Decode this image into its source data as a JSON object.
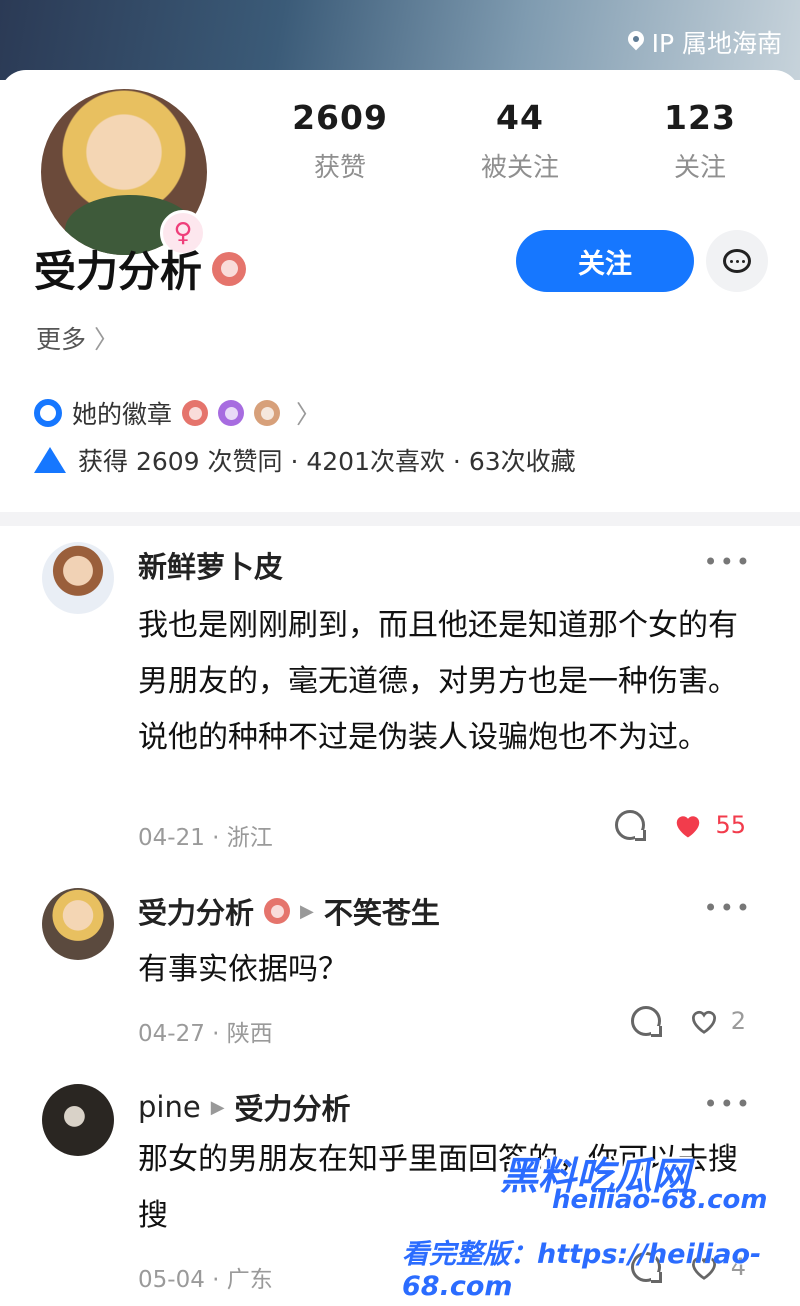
{
  "header": {
    "ip_location": "IP 属地海南",
    "gender_symbol": "♀"
  },
  "profile": {
    "stats": [
      {
        "value": "2609",
        "label": "获赞"
      },
      {
        "value": "44",
        "label": "被关注"
      },
      {
        "value": "123",
        "label": "关注"
      }
    ],
    "name": "受力分析",
    "follow_label": "关注",
    "more_label": "更多",
    "badges_label": "她的徽章",
    "summary": "获得 2609 次赞同 · 4201次喜欢 · 63次收藏"
  },
  "comments": [
    {
      "user": "新鲜萝卜皮",
      "reply_to": "",
      "text": "我也是刚刚刷到，而且他还是知道那个女的有男朋友的，毫无道德，对男方也是一种伤害。说他的种种不过是伪装人设骗炮也不为过。",
      "meta": "04-21 · 浙江",
      "likes": "55",
      "liked": true
    },
    {
      "user": "受力分析",
      "reply_to": "不笑苍生",
      "text": "有事实依据吗？",
      "meta": "04-27 · 陕西",
      "likes": "2",
      "liked": false
    },
    {
      "user": "pine",
      "reply_to": "受力分析",
      "text": "那女的男朋友在知乎里面回答的，你可以去搜搜",
      "meta": "05-04 · 广东",
      "likes": "4",
      "liked": false
    }
  ],
  "watermark": {
    "line1": "黑料吃瓜网",
    "line2": "heiliao-68.com",
    "line3": "看完整版：https://heiliao-68.com"
  },
  "colors": {
    "accent": "#1677ff",
    "heart_red": "#f23c4c",
    "gender_pink": "#ef3f7a"
  }
}
